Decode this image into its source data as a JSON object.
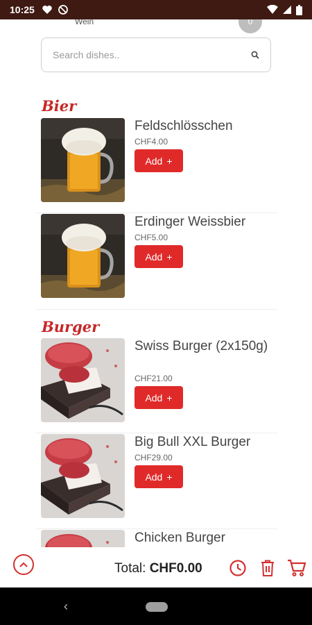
{
  "status_bar": {
    "time": "10:25"
  },
  "top_fragment": {
    "text": "Wein",
    "badge": "0"
  },
  "search": {
    "placeholder": "Search dishes.."
  },
  "categories": [
    {
      "title": "Bier",
      "items": [
        {
          "name": "Feldschlösschen",
          "price": "CHF4.00",
          "add_label": "Add",
          "image": "beer"
        },
        {
          "name": "Erdinger Weissbier",
          "price": "CHF5.00",
          "add_label": "Add",
          "image": "beer"
        }
      ]
    },
    {
      "title": "Burger",
      "items": [
        {
          "name": "Swiss Burger (2x150g)",
          "price": "CHF21.00",
          "add_label": "Add",
          "image": "burger-patty"
        },
        {
          "name": "Big Bull XXL Burger",
          "price": "CHF29.00",
          "add_label": "Add",
          "image": "burger-patty"
        },
        {
          "name": "Chicken Burger",
          "price": "",
          "add_label": "",
          "image": "burger-patty"
        }
      ]
    }
  ],
  "bottom_bar": {
    "total_label": "Total:",
    "total_value": "CHF0.00"
  },
  "colors": {
    "accent": "#e02a2a",
    "status_bar": "#3e1a12",
    "category": "#c62828"
  }
}
